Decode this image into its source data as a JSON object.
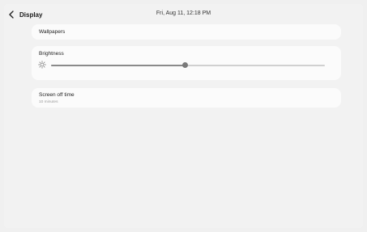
{
  "header": {
    "title": "Display",
    "datetime": "Fri, Aug 11, 12:18 PM"
  },
  "settings": {
    "wallpapers": {
      "label": "Wallpapers"
    },
    "brightness": {
      "label": "Brightness",
      "level": 0.49
    },
    "screen_off": {
      "label": "Screen off time",
      "value": "10 minutes"
    }
  },
  "icons": {
    "back": "chevron-left-icon",
    "brightness": "sun-icon"
  },
  "colors": {
    "background": "#f2f2f2",
    "card": "#fbfbfb",
    "slider_active": "#8a8a8a",
    "slider_track": "#d0d0d0"
  }
}
